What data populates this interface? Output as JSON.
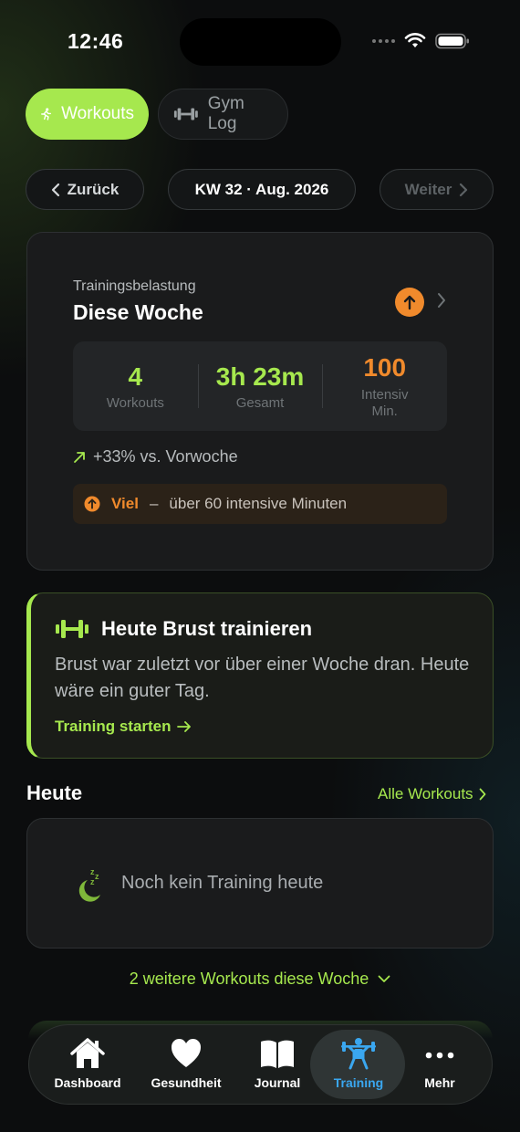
{
  "status_bar": {
    "time": "12:46"
  },
  "tabs": [
    {
      "label": "Workouts",
      "active": true
    },
    {
      "label": "Gym Log",
      "active": false
    }
  ],
  "week_nav": {
    "back": "Zurück",
    "week": "KW 32 · Aug. 2026",
    "next": "Weiter"
  },
  "load_card": {
    "label": "Trainingsbelastung",
    "title": "Diese Woche",
    "stats": [
      {
        "value": "4",
        "label": "Workouts"
      },
      {
        "value": "3h 23m",
        "label": "Gesamt"
      },
      {
        "value": "100",
        "label": "Intensiv Min."
      }
    ],
    "trend": "+33% vs. Vorwoche",
    "level_strong": "Viel",
    "level_dash": "–",
    "level_desc": "über 60 intensive Minuten"
  },
  "suggestion": {
    "title": "Heute Brust trainieren",
    "text": "Brust war zuletzt vor über einer Woche dran. Heute wäre ein guter Tag.",
    "link": "Training starten"
  },
  "today": {
    "title": "Heute",
    "all_link": "Alle Workouts",
    "empty": "Noch kein Training heute",
    "more": "2 weitere Workouts diese Woche"
  },
  "tabbar": [
    {
      "label": "Dashboard",
      "icon": "house-icon"
    },
    {
      "label": "Gesundheit",
      "icon": "heart-icon"
    },
    {
      "label": "Journal",
      "icon": "book-icon"
    },
    {
      "label": "Training",
      "icon": "weightlifter-icon",
      "active": true
    },
    {
      "label": "Mehr",
      "icon": "more-dots-icon"
    }
  ],
  "colors": {
    "accent_green": "#a6e84e",
    "accent_orange": "#f08a2c",
    "active_blue": "#3aa7f0",
    "background": "#0c0d0e"
  }
}
